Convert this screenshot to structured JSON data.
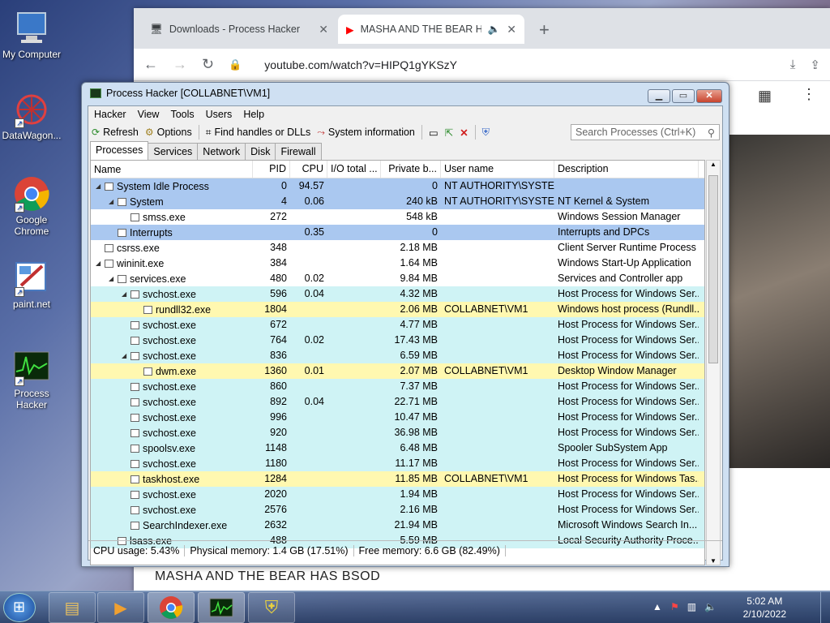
{
  "desktop": {
    "icons": [
      {
        "label": "My Computer"
      },
      {
        "label": "DataWagon..."
      },
      {
        "label": "Google Chrome"
      },
      {
        "label": "paint.net"
      },
      {
        "label": "Process Hacker"
      }
    ]
  },
  "browser": {
    "tabs": [
      {
        "label": "Downloads - Process Hacker"
      },
      {
        "label": "MASHA AND THE BEAR HAS"
      }
    ],
    "url": "youtube.com/watch?v=HIPQ1gYKSzY",
    "video_title": "MASHA AND THE BEAR HAS BSOD"
  },
  "ph": {
    "title": "Process Hacker [COLLABNET\\VM1]",
    "menu": [
      "Hacker",
      "View",
      "Tools",
      "Users",
      "Help"
    ],
    "toolbar": {
      "refresh": "Refresh",
      "options": "Options",
      "find": "Find handles or DLLs",
      "sysinfo": "System information"
    },
    "search_placeholder": "Search Processes (Ctrl+K)",
    "tabs": [
      "Processes",
      "Services",
      "Network",
      "Disk",
      "Firewall"
    ],
    "columns": [
      "Name",
      "PID",
      "CPU",
      "I/O total ...",
      "Private b...",
      "User name",
      "Description"
    ],
    "rows": [
      {
        "name": "System Idle Process",
        "pid": "0",
        "cpu": "94.57",
        "io": "",
        "priv": "0",
        "user": "NT AUTHORITY\\SYSTEM",
        "desc": "",
        "depth": 0,
        "exp": "◢",
        "bg": "sys"
      },
      {
        "name": "System",
        "pid": "4",
        "cpu": "0.06",
        "io": "",
        "priv": "240 kB",
        "user": "NT AUTHORITY\\SYSTEM",
        "desc": "NT Kernel & System",
        "depth": 1,
        "exp": "◢",
        "bg": "sys"
      },
      {
        "name": "smss.exe",
        "pid": "272",
        "cpu": "",
        "io": "",
        "priv": "548 kB",
        "user": "",
        "desc": "Windows Session Manager",
        "depth": 2,
        "exp": "",
        "bg": "none"
      },
      {
        "name": "Interrupts",
        "pid": "",
        "cpu": "0.35",
        "io": "",
        "priv": "0",
        "user": "",
        "desc": "Interrupts and DPCs",
        "depth": 1,
        "exp": "",
        "bg": "sys"
      },
      {
        "name": "csrss.exe",
        "pid": "348",
        "cpu": "",
        "io": "",
        "priv": "2.18 MB",
        "user": "",
        "desc": "Client Server Runtime Process",
        "depth": 0,
        "exp": "",
        "bg": "none"
      },
      {
        "name": "wininit.exe",
        "pid": "384",
        "cpu": "",
        "io": "",
        "priv": "1.64 MB",
        "user": "",
        "desc": "Windows Start-Up Application",
        "depth": 0,
        "exp": "◢",
        "bg": "none"
      },
      {
        "name": "services.exe",
        "pid": "480",
        "cpu": "0.02",
        "io": "",
        "priv": "9.84 MB",
        "user": "",
        "desc": "Services and Controller app",
        "depth": 1,
        "exp": "◢",
        "bg": "none"
      },
      {
        "name": "svchost.exe",
        "pid": "596",
        "cpu": "0.04",
        "io": "",
        "priv": "4.32 MB",
        "user": "",
        "desc": "Host Process for Windows Ser...",
        "depth": 2,
        "exp": "◢",
        "bg": "svc"
      },
      {
        "name": "rundll32.exe",
        "pid": "1804",
        "cpu": "",
        "io": "",
        "priv": "2.06 MB",
        "user": "COLLABNET\\VM1",
        "desc": "Windows host process (Rundll...",
        "depth": 3,
        "exp": "",
        "bg": "usr"
      },
      {
        "name": "svchost.exe",
        "pid": "672",
        "cpu": "",
        "io": "",
        "priv": "4.77 MB",
        "user": "",
        "desc": "Host Process for Windows Ser...",
        "depth": 2,
        "exp": "",
        "bg": "svc"
      },
      {
        "name": "svchost.exe",
        "pid": "764",
        "cpu": "0.02",
        "io": "",
        "priv": "17.43 MB",
        "user": "",
        "desc": "Host Process for Windows Ser...",
        "depth": 2,
        "exp": "",
        "bg": "svc"
      },
      {
        "name": "svchost.exe",
        "pid": "836",
        "cpu": "",
        "io": "",
        "priv": "6.59 MB",
        "user": "",
        "desc": "Host Process for Windows Ser...",
        "depth": 2,
        "exp": "◢",
        "bg": "svc"
      },
      {
        "name": "dwm.exe",
        "pid": "1360",
        "cpu": "0.01",
        "io": "",
        "priv": "2.07 MB",
        "user": "COLLABNET\\VM1",
        "desc": "Desktop Window Manager",
        "depth": 3,
        "exp": "",
        "bg": "usr"
      },
      {
        "name": "svchost.exe",
        "pid": "860",
        "cpu": "",
        "io": "",
        "priv": "7.37 MB",
        "user": "",
        "desc": "Host Process for Windows Ser...",
        "depth": 2,
        "exp": "",
        "bg": "svc"
      },
      {
        "name": "svchost.exe",
        "pid": "892",
        "cpu": "0.04",
        "io": "",
        "priv": "22.71 MB",
        "user": "",
        "desc": "Host Process for Windows Ser...",
        "depth": 2,
        "exp": "",
        "bg": "svc"
      },
      {
        "name": "svchost.exe",
        "pid": "996",
        "cpu": "",
        "io": "",
        "priv": "10.47 MB",
        "user": "",
        "desc": "Host Process for Windows Ser...",
        "depth": 2,
        "exp": "",
        "bg": "svc"
      },
      {
        "name": "svchost.exe",
        "pid": "920",
        "cpu": "",
        "io": "",
        "priv": "36.98 MB",
        "user": "",
        "desc": "Host Process for Windows Ser...",
        "depth": 2,
        "exp": "",
        "bg": "svc"
      },
      {
        "name": "spoolsv.exe",
        "pid": "1148",
        "cpu": "",
        "io": "",
        "priv": "6.48 MB",
        "user": "",
        "desc": "Spooler SubSystem App",
        "depth": 2,
        "exp": "",
        "bg": "svc"
      },
      {
        "name": "svchost.exe",
        "pid": "1180",
        "cpu": "",
        "io": "",
        "priv": "11.17 MB",
        "user": "",
        "desc": "Host Process for Windows Ser...",
        "depth": 2,
        "exp": "",
        "bg": "svc"
      },
      {
        "name": "taskhost.exe",
        "pid": "1284",
        "cpu": "",
        "io": "",
        "priv": "11.85 MB",
        "user": "COLLABNET\\VM1",
        "desc": "Host Process for Windows Tas...",
        "depth": 2,
        "exp": "",
        "bg": "usr"
      },
      {
        "name": "svchost.exe",
        "pid": "2020",
        "cpu": "",
        "io": "",
        "priv": "1.94 MB",
        "user": "",
        "desc": "Host Process for Windows Ser...",
        "depth": 2,
        "exp": "",
        "bg": "svc"
      },
      {
        "name": "svchost.exe",
        "pid": "2576",
        "cpu": "",
        "io": "",
        "priv": "2.16 MB",
        "user": "",
        "desc": "Host Process for Windows Ser...",
        "depth": 2,
        "exp": "",
        "bg": "svc"
      },
      {
        "name": "SearchIndexer.exe",
        "pid": "2632",
        "cpu": "",
        "io": "",
        "priv": "21.94 MB",
        "user": "",
        "desc": "Microsoft Windows Search In...",
        "depth": 2,
        "exp": "",
        "bg": "svc"
      },
      {
        "name": "lsass.exe",
        "pid": "488",
        "cpu": "",
        "io": "",
        "priv": "5.59 MB",
        "user": "",
        "desc": "Local Security Authority Proce...",
        "depth": 1,
        "exp": "",
        "bg": "svc"
      }
    ],
    "status": {
      "cpu": "CPU usage: 5.43%",
      "phys": "Physical memory: 1.4 GB (17.51%)",
      "free": "Free memory: 6.6 GB (82.49%)"
    }
  },
  "taskbar": {
    "time": "5:02 AM",
    "date": "2/10/2022"
  },
  "colors": {
    "row_system": "#aac8f0",
    "row_service": "#cff3f5",
    "row_user": "#fff8b0"
  }
}
